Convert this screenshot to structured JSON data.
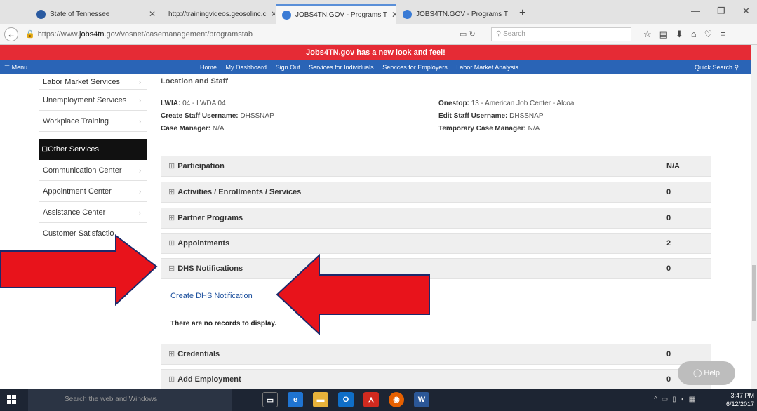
{
  "browser": {
    "tabs": [
      {
        "label": "State of Tennessee"
      },
      {
        "label": "http://trainingvideos.geosolinc.c"
      },
      {
        "label": "JOBS4TN.GOV - Programs T"
      },
      {
        "label": "JOBS4TN.GOV - Programs T"
      }
    ],
    "url_prefix": "https://www.",
    "url_domain": "jobs4tn",
    "url_suffix": ".gov/vosnet/casemanagement/programstab",
    "search_placeholder": "Search"
  },
  "site": {
    "banner": "Jobs4TN.gov has a new look and feel!",
    "menu_label": "Menu",
    "nav_links": [
      "Home",
      "My Dashboard",
      "Sign Out",
      "Services for Individuals",
      "Services for Employers",
      "Labor Market Analysis"
    ],
    "quick_search": "Quick Search"
  },
  "sidebar": {
    "items_top": [
      "Labor Market Services",
      "Unemployment Services",
      "Workplace Training"
    ],
    "section_header": "Other Services",
    "items_bottom": [
      "Communication Center",
      "Appointment Center",
      "Assistance Center",
      "Customer Satisfactio"
    ]
  },
  "main": {
    "section_title": "Location and Staff",
    "lwia_label": "LWIA:",
    "lwia_value": "04 - LWDA 04",
    "onestop_label": "Onestop:",
    "onestop_value": "13 - American Job Center - Alcoa",
    "create_staff_label": "Create Staff Username:",
    "create_staff_value": "DHSSNAP",
    "edit_staff_label": "Edit Staff Username:",
    "edit_staff_value": "DHSSNAP",
    "case_manager_label": "Case Manager:",
    "case_manager_value": "N/A",
    "temp_case_manager_label": "Temporary Case Manager:",
    "temp_case_manager_value": "N/A",
    "rows": [
      {
        "label": "Participation",
        "count": "N/A"
      },
      {
        "label": "Activities / Enrollments / Services",
        "count": "0"
      },
      {
        "label": "Partner Programs",
        "count": "0"
      },
      {
        "label": "Appointments",
        "count": "2"
      },
      {
        "label": "DHS Notifications",
        "count": "0"
      },
      {
        "label": "Credentials",
        "count": "0"
      },
      {
        "label": "Add Employment",
        "count": "0"
      }
    ],
    "create_link": "Create DHS Notification",
    "no_records": "There are no records to display."
  },
  "help_label": "Help",
  "taskbar": {
    "search_placeholder": "Search the web and Windows",
    "time": "3:47 PM",
    "date": "6/12/2017"
  },
  "colors": {
    "banner": "#e52b35",
    "nav": "#2a64b6",
    "arrow": "#e8131b",
    "link": "#1a4e9c"
  }
}
